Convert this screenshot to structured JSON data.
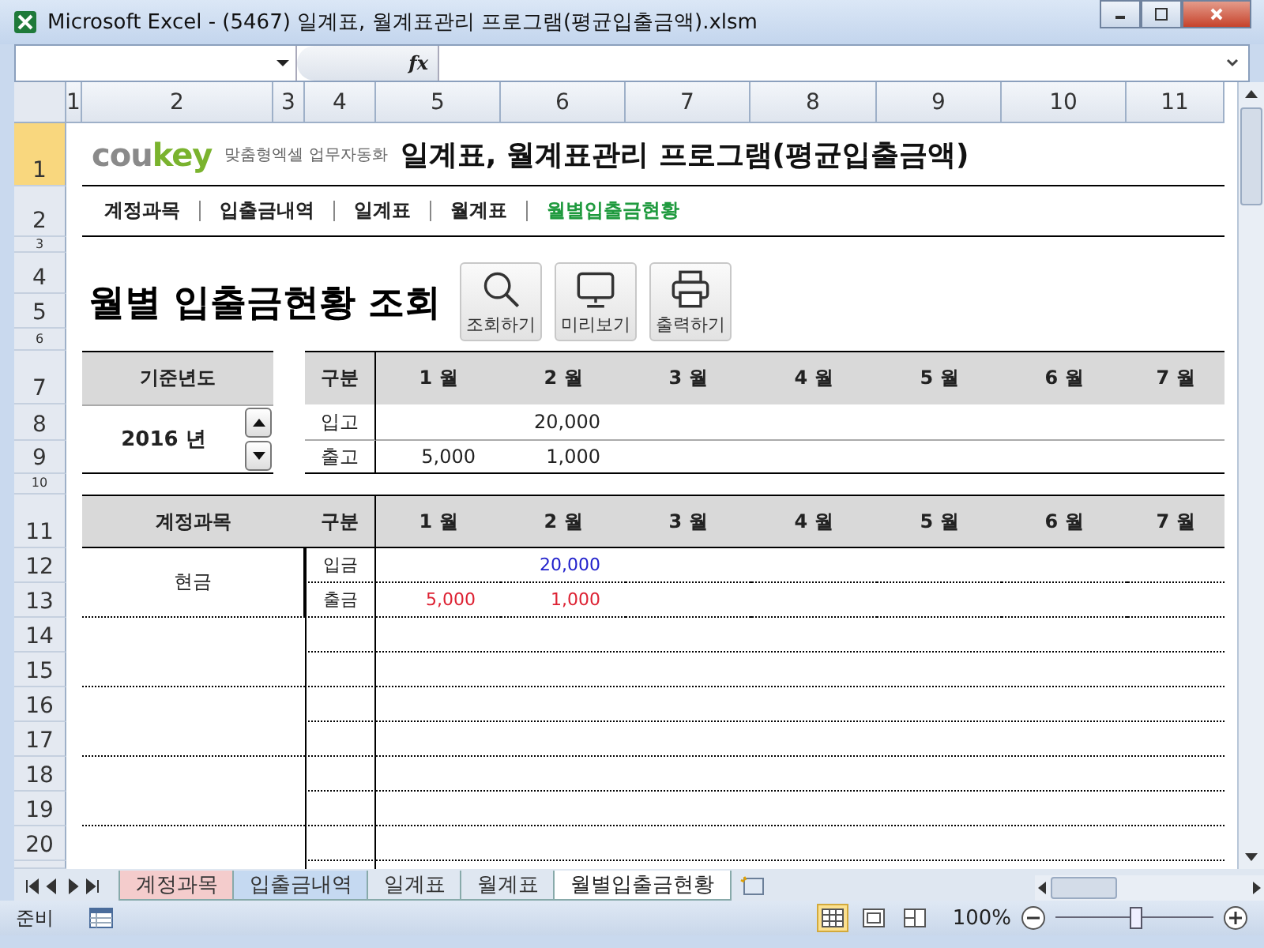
{
  "window": {
    "title": "Microsoft Excel - (5467) 일계표, 월계표관리 프로그램(평균입출금액).xlsm"
  },
  "formula_bar": {
    "function_label": "fx"
  },
  "column_headers": [
    "1",
    "2",
    "3",
    "4",
    "5",
    "6",
    "7",
    "8",
    "9",
    "10",
    "11"
  ],
  "row_headers": [
    "1",
    "2",
    "3",
    "4",
    "5",
    "6",
    "7",
    "8",
    "9",
    "10",
    "11",
    "12",
    "13",
    "14",
    "15",
    "16",
    "17",
    "18",
    "19",
    "20"
  ],
  "banner": {
    "logo_parts": [
      "cou",
      "key"
    ],
    "tagline": "맞춤형엑셀 업무자동화",
    "title": "일계표, 월계표관리 프로그램(평균입출금액)"
  },
  "nav": [
    {
      "label": "계정과목",
      "selected": false
    },
    {
      "label": "입출금내역",
      "selected": false
    },
    {
      "label": "일계표",
      "selected": false
    },
    {
      "label": "월계표",
      "selected": false
    },
    {
      "label": "월별입출금현황",
      "selected": true
    }
  ],
  "page_title": "월별 입출금현황 조회",
  "buttons": [
    {
      "kind": "search",
      "label": "조회하기"
    },
    {
      "kind": "preview",
      "label": "미리보기"
    },
    {
      "kind": "print",
      "label": "출력하기"
    }
  ],
  "year_box": {
    "label": "기준년도",
    "value": "2016 년"
  },
  "summary": {
    "columns": [
      "구분",
      "1 월",
      "2 월",
      "3 월",
      "4 월",
      "5 월",
      "6 월",
      "7 월"
    ],
    "rows": [
      {
        "label": "입고",
        "month_2": "20,000"
      },
      {
        "label": "출고",
        "month_1": "5,000",
        "month_2": "1,000"
      }
    ]
  },
  "detail": {
    "columns": [
      "계정과목",
      "구분",
      "1 월",
      "2 월",
      "3 월",
      "4 월",
      "5 월",
      "6 월",
      "7 월"
    ],
    "account": "현금",
    "rows": [
      {
        "label": "입금",
        "kind": "deposit",
        "month_2": "20,000"
      },
      {
        "label": "출금",
        "kind": "withdrawal",
        "month_1": "5,000",
        "month_2": "1,000"
      }
    ]
  },
  "sheet_tabs": [
    {
      "label": "계정과목",
      "selected": false,
      "color": "#f4cccc"
    },
    {
      "label": "입출금내역",
      "selected": false,
      "color": "#c5d9f1"
    },
    {
      "label": "일계표",
      "selected": false
    },
    {
      "label": "월계표",
      "selected": false
    },
    {
      "label": "월별입출금현황",
      "selected": true
    }
  ],
  "status_bar": {
    "status": "준비",
    "zoom": "100%",
    "zoom_slider": {
      "level": 0.5
    },
    "views": [
      {
        "kind": "normal",
        "selected": true
      },
      {
        "kind": "layout",
        "selected": false
      },
      {
        "kind": "pagebreak",
        "selected": false
      }
    ]
  }
}
